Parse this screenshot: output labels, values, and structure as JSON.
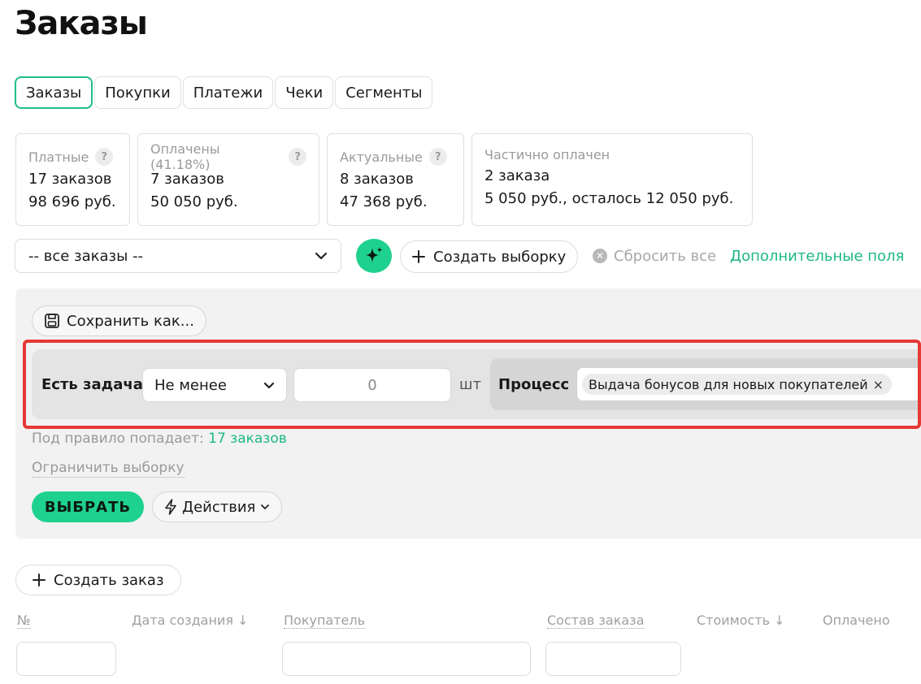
{
  "page": {
    "title": "Заказы"
  },
  "tabs": [
    {
      "label": "Заказы",
      "active": true
    },
    {
      "label": "Покупки",
      "active": false
    },
    {
      "label": "Платежи",
      "active": false
    },
    {
      "label": "Чеки",
      "active": false
    },
    {
      "label": "Сегменты",
      "active": false
    }
  ],
  "stats": [
    {
      "label": "Платные",
      "help": "?",
      "line1": "17 заказов",
      "line2": "98 696 руб."
    },
    {
      "label": "Оплачены (41.18%)",
      "help": "?",
      "line1": "7 заказов",
      "line2": "50 050 руб."
    },
    {
      "label": "Актуальные",
      "help": "?",
      "line1": "8 заказов",
      "line2": "47 368 руб."
    },
    {
      "label": "Частично оплачен",
      "line1": "2 заказа",
      "line2": "5 050 руб., осталось 12 050 руб."
    }
  ],
  "filters": {
    "main_select": "-- все заказы --",
    "create_selection": "Создать выборку",
    "reset_all": "Сбросить все",
    "more_fields": "Дополнительные поля"
  },
  "panel": {
    "save_as": "Сохранить как...",
    "rule": {
      "label": "Есть задача",
      "operator": "Не менее",
      "value": "0",
      "unit": "шт",
      "process_label": "Процесс",
      "process_chip": "Выдача бонусов для новых покупателей",
      "chip_remove": "×"
    },
    "match_text": "Под правило попадает:",
    "match_count": "17 заказов",
    "limit": "Ограничить выборку",
    "select_button": "ВЫБРАТЬ",
    "actions": "Действия"
  },
  "create_order": "Создать заказ",
  "table": {
    "columns": [
      "№",
      "Дата создания ↓",
      "Покупатель",
      "Состав заказа",
      "Стоимость ↓",
      "Оплачено"
    ]
  },
  "colors": {
    "accent": "#1fd18f",
    "link": "#1db97f",
    "highlight": "#e53935"
  }
}
